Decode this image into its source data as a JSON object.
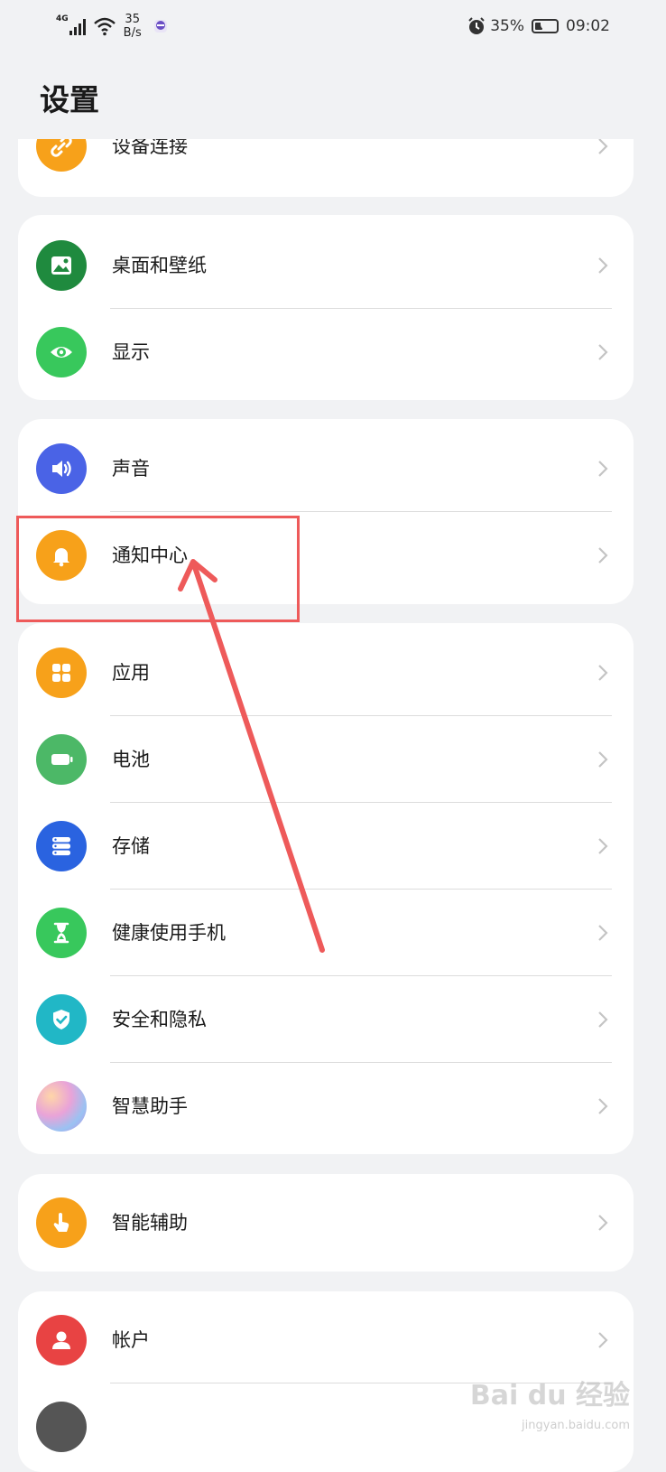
{
  "status_bar": {
    "network": "4G",
    "speed_value": "35",
    "speed_unit": "B/s",
    "battery": "35%",
    "battery_level": 0.35,
    "time": "09:02"
  },
  "page": {
    "title": "设置"
  },
  "groups": [
    {
      "items": [
        {
          "label": "设备连接",
          "icon": "link-icon",
          "color": "#f7a11a"
        }
      ]
    },
    {
      "items": [
        {
          "label": "桌面和壁纸",
          "icon": "picture-icon",
          "color": "#1f8a3e"
        },
        {
          "label": "显示",
          "icon": "eye-icon",
          "color": "#38c85c"
        }
      ]
    },
    {
      "items": [
        {
          "label": "声音",
          "icon": "speaker-icon",
          "color": "#4a63e6"
        },
        {
          "label": "通知中心",
          "icon": "bell-icon",
          "color": "#f7a11a"
        }
      ]
    },
    {
      "items": [
        {
          "label": "应用",
          "icon": "apps-grid-icon",
          "color": "#f7a11a"
        },
        {
          "label": "电池",
          "icon": "battery-icon",
          "color": "#4cb867"
        },
        {
          "label": "存储",
          "icon": "storage-icon",
          "color": "#2a63e0"
        },
        {
          "label": "健康使用手机",
          "icon": "hourglass-icon",
          "color": "#38c85c"
        },
        {
          "label": "安全和隐私",
          "icon": "shield-check-icon",
          "color": "#21b7c6"
        },
        {
          "label": "智慧助手",
          "icon": "assistant-orb-icon",
          "color": "#c58be0"
        }
      ]
    },
    {
      "items": [
        {
          "label": "智能辅助",
          "icon": "touch-hand-icon",
          "color": "#f7a11a"
        }
      ]
    },
    {
      "items": [
        {
          "label": "帐户",
          "icon": "user-icon",
          "color": "#e84343"
        },
        {
          "label": "",
          "icon": "partial-icon",
          "color": "#555555"
        }
      ]
    }
  ],
  "annotation": {
    "highlight_color": "#ee5a5a",
    "target": "通知中心"
  },
  "watermark": {
    "text": "Bai du 经验",
    "sub": "jingyan.baidu.com"
  }
}
